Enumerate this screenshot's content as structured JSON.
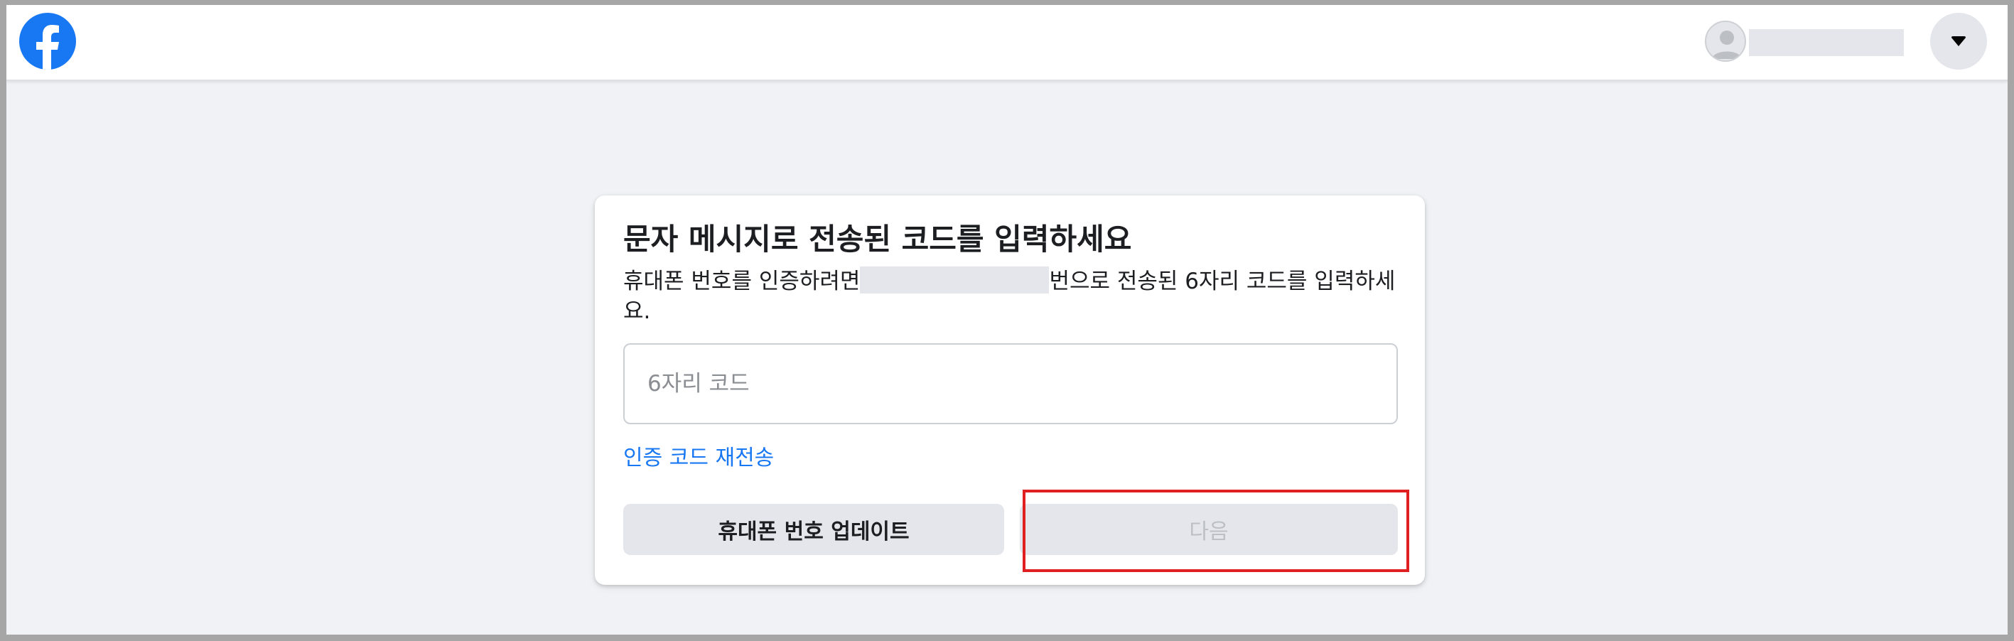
{
  "header": {
    "logo_icon": "facebook-logo-icon",
    "avatar_icon": "default-avatar-icon",
    "menu_icon": "caret-down-icon"
  },
  "dialog": {
    "title": "문자 메시지로 전송된 코드를 입력하세요",
    "description_before": "휴대폰 번호를 인증하려면",
    "description_after": "번으로 전송된 6자리 코드를 입력하세요.",
    "code_input": {
      "placeholder": "6자리 코드",
      "value": ""
    },
    "resend_link": "인증 코드 재전송",
    "update_phone_button": "휴대폰 번호 업데이트",
    "next_button": "다음"
  },
  "colors": {
    "brand_blue": "#1877f2",
    "highlight_red": "#e02020",
    "disabled_text": "#bcc0c4"
  }
}
